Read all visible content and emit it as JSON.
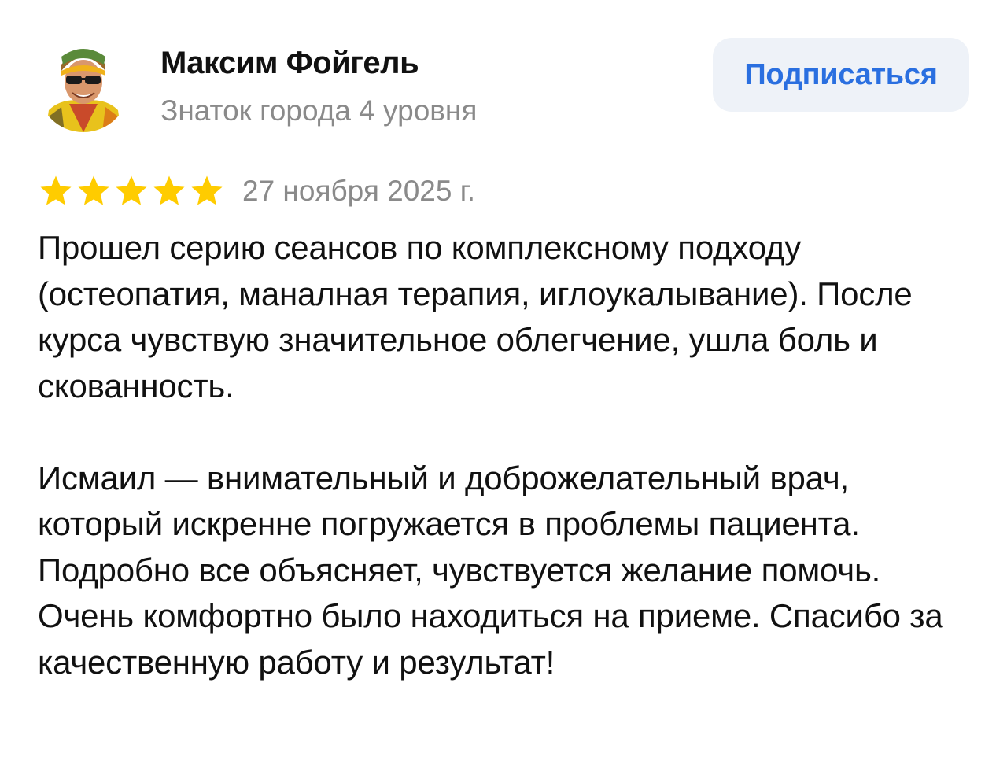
{
  "author": {
    "name": "Максим Фойгель",
    "level": "Знаток города 4 уровня",
    "avatar_icon": "user-photo-avatar"
  },
  "subscribe": {
    "label": "Подписаться"
  },
  "review": {
    "rating": 5,
    "rating_max": 5,
    "date": "27 ноября 2025 г.",
    "paragraphs": [
      "Прошел серию сеансов по комплексному подходу (остеопатия, маналная терапия, иглоукалывание). После курса чувствую значительное облегчение, ушла боль и скованность.",
      "Исмаил — внимательный и доброжелательный врач, который искренне погружается в проблемы пациента. Подробно все объясняет, чувствуется желание помочь. Очень комфортно было находиться на приеме. Спасибо за качественную работу и результат!"
    ]
  },
  "colors": {
    "accent": "#2a6fe0",
    "button_bg": "#eef2f8",
    "star": "#ffcc00",
    "secondary_text": "#8a8a8a"
  }
}
